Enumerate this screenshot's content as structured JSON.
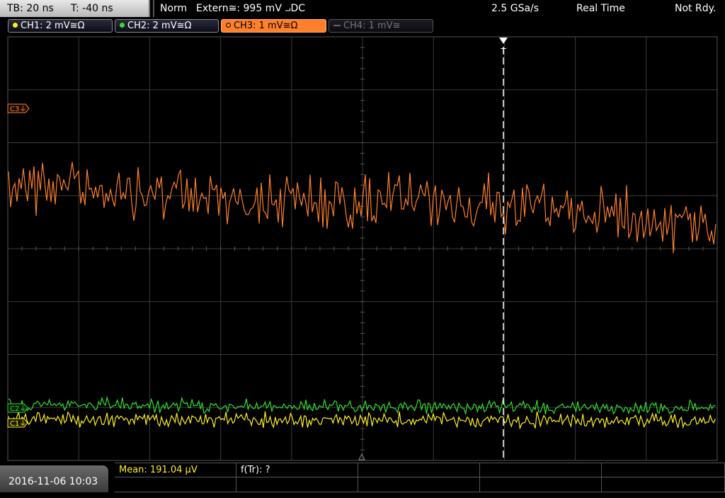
{
  "topbar": {
    "timebase": "TB: 20 ns",
    "trigger_offset": "T: -40 ns",
    "trigger_mode": "Norm",
    "trigger_source": "Extern≅: 995 mV ⨼DC",
    "sample_rate": "2.5 GSa/s",
    "acq_mode": "Real Time",
    "status": "Not Rdy."
  },
  "channels": [
    {
      "label": "CH1: 2 mV≅Ω",
      "color": "#ffef20",
      "state": "on"
    },
    {
      "label": "CH2: 2 mV≅Ω",
      "color": "#30e030",
      "state": "on"
    },
    {
      "label": "CH3: 1 mV≅Ω",
      "color": "#ff7f2a",
      "state": "selected"
    },
    {
      "label": "CH4: 1 mV≅",
      "color": "#777777",
      "state": "off"
    }
  ],
  "markers": {
    "ch3_ground": "C3⏚",
    "ch2_ground": "C2⏚",
    "ch1_ground": "C1⏚",
    "trigger_marker": "T"
  },
  "colors": {
    "ch1": "#ffef20",
    "ch2": "#30e030",
    "ch3": "#ff7f2a",
    "grid": "#3a3a3a",
    "trigger_line": "#ffffff"
  },
  "bottombar": {
    "datetime": "2016-11-06 10:03",
    "measurements": [
      {
        "label": "Mean: 191.04 µV",
        "color": "#ffef20"
      },
      {
        "label": "f(Tr): ?",
        "color": "#ffffff"
      }
    ]
  }
}
